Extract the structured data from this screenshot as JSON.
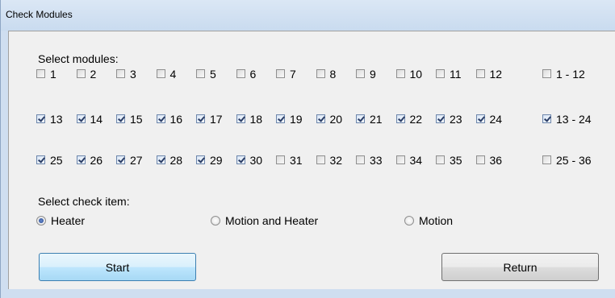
{
  "window": {
    "title": "Check Modules"
  },
  "modules": {
    "label": "Select modules:",
    "rows": [
      {
        "items": [
          {
            "label": "1",
            "checked": false
          },
          {
            "label": "2",
            "checked": false
          },
          {
            "label": "3",
            "checked": false
          },
          {
            "label": "4",
            "checked": false
          },
          {
            "label": "5",
            "checked": false
          },
          {
            "label": "6",
            "checked": false
          },
          {
            "label": "7",
            "checked": false
          },
          {
            "label": "8",
            "checked": false
          },
          {
            "label": "9",
            "checked": false
          },
          {
            "label": "10",
            "checked": false
          },
          {
            "label": "11",
            "checked": false
          },
          {
            "label": "12",
            "checked": false
          }
        ],
        "range": {
          "label": "1 - 12",
          "checked": false
        }
      },
      {
        "items": [
          {
            "label": "13",
            "checked": true
          },
          {
            "label": "14",
            "checked": true
          },
          {
            "label": "15",
            "checked": true
          },
          {
            "label": "16",
            "checked": true
          },
          {
            "label": "17",
            "checked": true
          },
          {
            "label": "18",
            "checked": true
          },
          {
            "label": "19",
            "checked": true
          },
          {
            "label": "20",
            "checked": true
          },
          {
            "label": "21",
            "checked": true
          },
          {
            "label": "22",
            "checked": true
          },
          {
            "label": "23",
            "checked": true
          },
          {
            "label": "24",
            "checked": true
          }
        ],
        "range": {
          "label": "13 - 24",
          "checked": true
        }
      },
      {
        "items": [
          {
            "label": "25",
            "checked": true
          },
          {
            "label": "26",
            "checked": true
          },
          {
            "label": "27",
            "checked": true
          },
          {
            "label": "28",
            "checked": true
          },
          {
            "label": "29",
            "checked": true
          },
          {
            "label": "30",
            "checked": true
          },
          {
            "label": "31",
            "checked": false
          },
          {
            "label": "32",
            "checked": false
          },
          {
            "label": "33",
            "checked": false
          },
          {
            "label": "34",
            "checked": false
          },
          {
            "label": "35",
            "checked": false
          },
          {
            "label": "36",
            "checked": false
          }
        ],
        "range": {
          "label": "25 - 36",
          "checked": false
        }
      }
    ]
  },
  "check_item": {
    "label": "Select check item:",
    "options": [
      {
        "label": "Heater",
        "selected": true
      },
      {
        "label": "Motion and Heater",
        "selected": false
      },
      {
        "label": "Motion",
        "selected": false
      }
    ]
  },
  "buttons": {
    "start": "Start",
    "return": "Return"
  }
}
